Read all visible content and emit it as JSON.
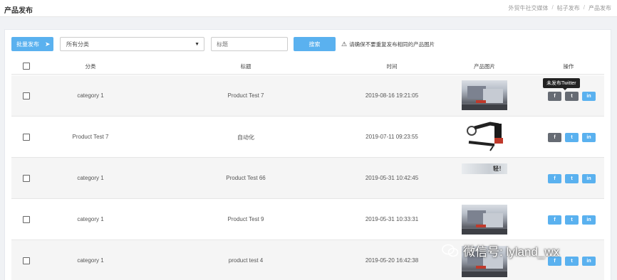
{
  "header": {
    "title": "产品发布",
    "breadcrumb": [
      "外贸牛社交媒体",
      "帖子发布",
      "产品发布"
    ]
  },
  "toolbar": {
    "batch_label": "批量发布",
    "category_select": "所有分类",
    "title_placeholder": "标题",
    "search_label": "搜索",
    "notice": "请确保不要重复发布相同的产品图片"
  },
  "table": {
    "columns": [
      "分类",
      "标题",
      "时间",
      "产品图片",
      "操作"
    ],
    "rows": [
      {
        "category": "category 1",
        "title": "Product Test 7",
        "time": "2019-08-16 19:21:05",
        "image": "machine-photo"
      },
      {
        "category": "Product Test 7",
        "title": "自动化",
        "time": "2019-07-11 09:23:55",
        "image": "robot-arm-photo"
      },
      {
        "category": "category 1",
        "title": "Product Test 66",
        "time": "2019-05-31 10:42:45",
        "image": "banner-photo",
        "image_text": "轻！"
      },
      {
        "category": "category 1",
        "title": "Product Test 9",
        "time": "2019-05-31 10:33:31",
        "image": "machine-photo"
      },
      {
        "category": "category 1",
        "title": "product test 4",
        "time": "2019-05-20 16:42:38",
        "image": "machine-photo"
      }
    ],
    "action_icons": {
      "facebook": "f",
      "twitter": "t",
      "linkedin": "in"
    }
  },
  "tooltip": "未发布Twitter",
  "watermark": "微信号: lyland_wx",
  "colors": {
    "accent": "#5ab1ef",
    "dark_button": "#666b73"
  }
}
